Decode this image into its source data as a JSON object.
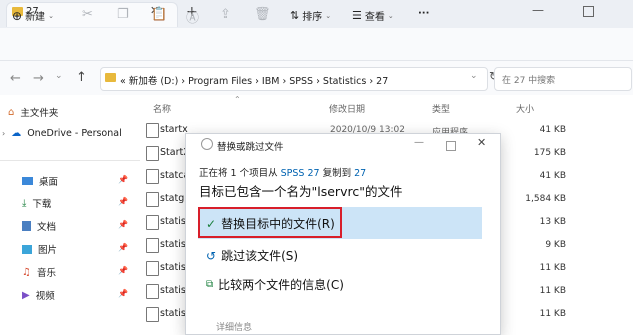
{
  "tab": {
    "title": "27",
    "close": "✕",
    "new": "+"
  },
  "window": {
    "minimize": "—"
  },
  "toolbar": {
    "new_label": "新建",
    "sort_label": "排序",
    "view_label": "查看",
    "more_label": "···"
  },
  "address": {
    "path": "«  新加卷 (D:)  ›  Program Files  ›  IBM  ›  SPSS  ›  Statistics  ›  27",
    "search_placeholder": "在 27 中搜索"
  },
  "sidebar": {
    "items": [
      {
        "label": "主文件夹",
        "icon": "home-icon"
      },
      {
        "label": "OneDrive - Personal",
        "icon": "cloud-icon"
      },
      {
        "label": "桌面",
        "icon": "desktop-icon"
      },
      {
        "label": "下载",
        "icon": "download-icon"
      },
      {
        "label": "文档",
        "icon": "document-icon"
      },
      {
        "label": "图片",
        "icon": "picture-icon"
      },
      {
        "label": "音乐",
        "icon": "music-icon"
      },
      {
        "label": "视频",
        "icon": "video-icon"
      }
    ]
  },
  "columns": {
    "name": "名称",
    "date": "修改日期",
    "type": "类型",
    "size": "大小"
  },
  "files": [
    {
      "name": "startx",
      "date": "2020/10/9 13:02",
      "type": "应用程序",
      "size": "41 KB"
    },
    {
      "name": "StartX",
      "date": "",
      "type": "",
      "size": "175 KB"
    },
    {
      "name": "statca",
      "date": "",
      "type": "",
      "size": "41 KB"
    },
    {
      "name": "statgu",
      "date": "",
      "type": "",
      "size": "1,584 KB"
    },
    {
      "name": "statis",
      "date": "",
      "type": "",
      "size": "13 KB"
    },
    {
      "name": "statis",
      "date": "",
      "type": "",
      "size": "9 KB"
    },
    {
      "name": "statis",
      "date": "",
      "type": "",
      "size": "11 KB"
    },
    {
      "name": "statis",
      "date": "",
      "type": "",
      "size": "11 KB"
    },
    {
      "name": "statis",
      "date": "",
      "type": "",
      "size": "11 KB"
    }
  ],
  "dialog": {
    "title": "替换或跳过文件",
    "line_prefix": "正在将 1 个项目从 ",
    "source": "SPSS 27",
    "line_mid": " 复制到 ",
    "dest": "27",
    "heading": "目标已包含一个名为\"lservrc\"的文件",
    "option_replace": "替换目标中的文件(R)",
    "option_skip": "跳过该文件(S)",
    "option_compare": "比较两个文件的信息(C)",
    "details": "详细信息"
  },
  "colors": {
    "highlight": "#cce4f7",
    "red_box": "#d81e2a",
    "link": "#0063b1"
  }
}
